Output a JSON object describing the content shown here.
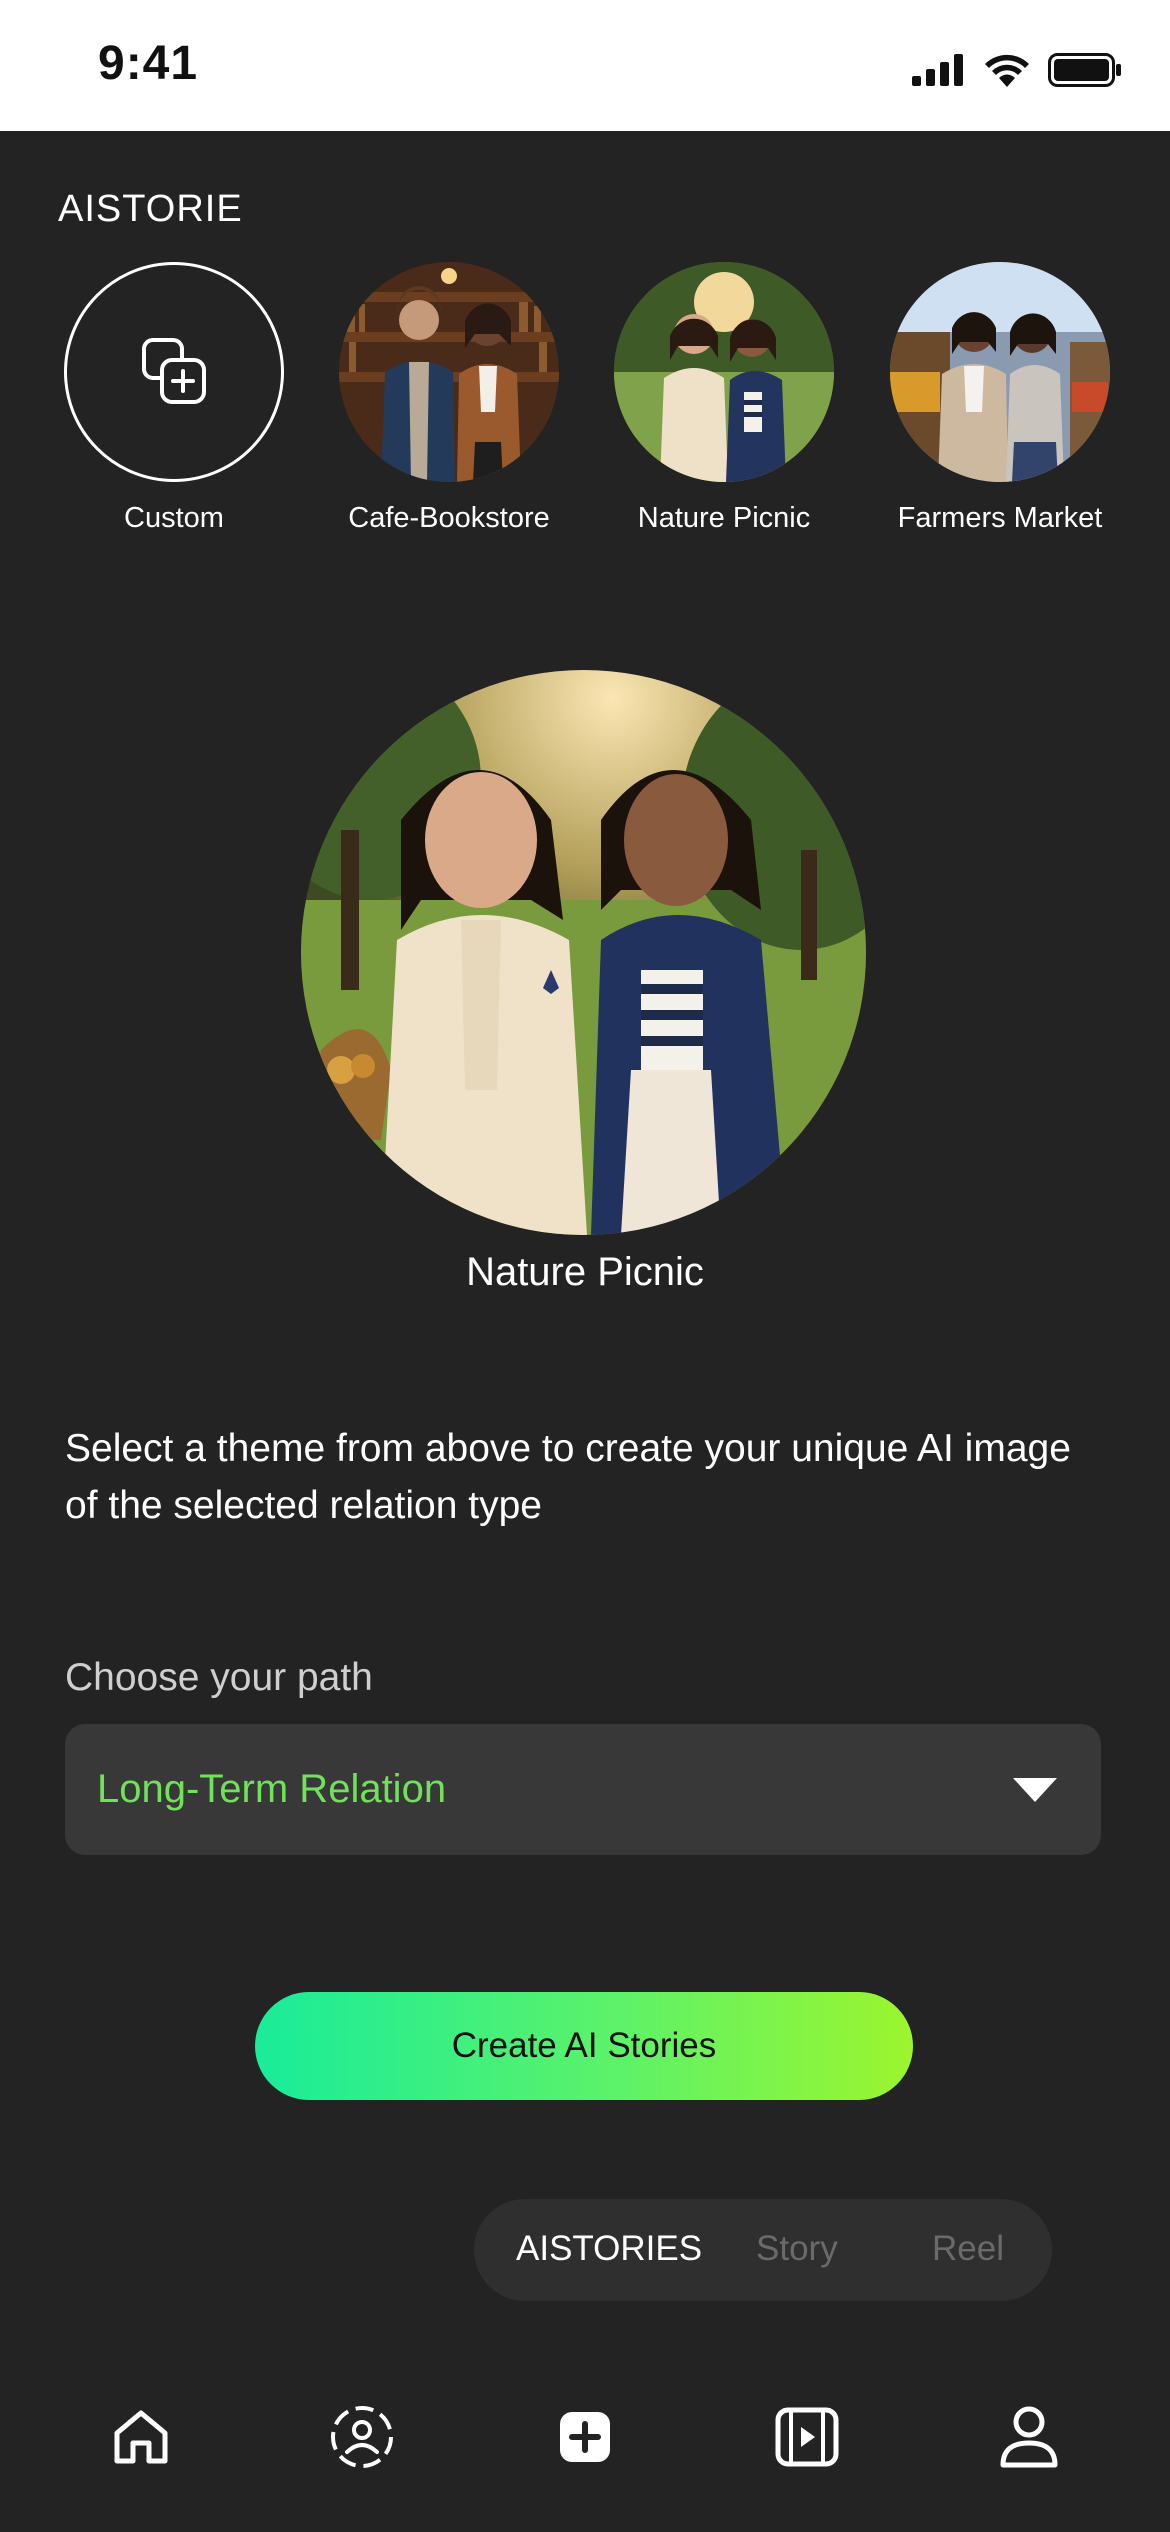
{
  "status_bar": {
    "time": "9:41"
  },
  "section_title": "AISTORIE",
  "themes": [
    {
      "label": "Custom"
    },
    {
      "label": "Cafe-Bookstore"
    },
    {
      "label": "Nature Picnic"
    },
    {
      "label": "Farmers Market"
    }
  ],
  "selected_theme": {
    "label": "Nature Picnic"
  },
  "description": "Select a theme from above to create your unique AI image of the selected relation type",
  "path": {
    "label": "Choose your path",
    "value": "Long-Term Relation"
  },
  "create_button": {
    "label": "Create AI Stories"
  },
  "mode_switch": {
    "tabs": [
      "AISTORIES",
      "Story",
      "Reel"
    ],
    "active": "AISTORIES"
  },
  "bottom_nav": [
    "home-icon",
    "profile-dashed-icon",
    "add-icon",
    "video-icon",
    "user-icon"
  ],
  "colors": {
    "background": "#232323",
    "accent_green": "#6fe25a",
    "gradient_start": "#19ec9a",
    "gradient_end": "#9cf52e"
  }
}
